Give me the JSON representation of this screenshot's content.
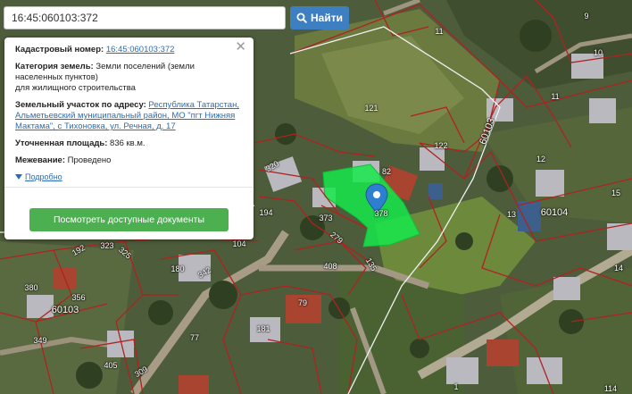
{
  "search": {
    "value": "16:45:060103:372",
    "button_label": "Найти"
  },
  "info_card": {
    "cadastral_label": "Кадастровый номер:",
    "cadastral_value": "16:45:060103:372",
    "category_label": "Категория земель:",
    "category_value": "Земли поселений (земли населенных пунктов)",
    "category_use": "для жилищного строительства",
    "address_label": "Земельный участок по адресу:",
    "address_value": "Республика Татарстан, Альметьевский муниципальный район, МО \"пгт Нижняя Мактама\", с Тихоновка, ул. Речная, д. 17",
    "area_label": "Уточненная площадь:",
    "area_value": "836 кв.м.",
    "survey_label": "Межевание:",
    "survey_value": "Проведено",
    "more_label": "Подробно",
    "docs_button": "Посмотреть доступные документы"
  },
  "map_labels": {
    "p9": "9",
    "p11a": "11",
    "p10": "10",
    "p11b": "11",
    "p121": "121",
    "p122": "122",
    "p82": "82",
    "p12": "12",
    "p13": "13",
    "p14": "14",
    "p15": "15",
    "p60104": "60104",
    "p60103a": "60103",
    "p320": "320",
    "p194": "194",
    "p373": "373",
    "p279": "279",
    "p104": "104",
    "p323": "323",
    "p325": "325",
    "p192": "192",
    "p408": "408",
    "p378": "378",
    "p135": "135",
    "p180": "180",
    "p342": "342",
    "p380": "380",
    "p356": "356",
    "p60103b": "60103",
    "p349": "349",
    "p79": "79",
    "p181": "181",
    "p77": "77",
    "p405": "405",
    "p309": "309",
    "p1": "1",
    "p114": "114"
  },
  "colors": {
    "selected_parcel": "#16e84a",
    "boundary": "#b02222",
    "marker": "#2f7fd0",
    "accent": "#3d7fc1",
    "button_green": "#4caf50"
  }
}
